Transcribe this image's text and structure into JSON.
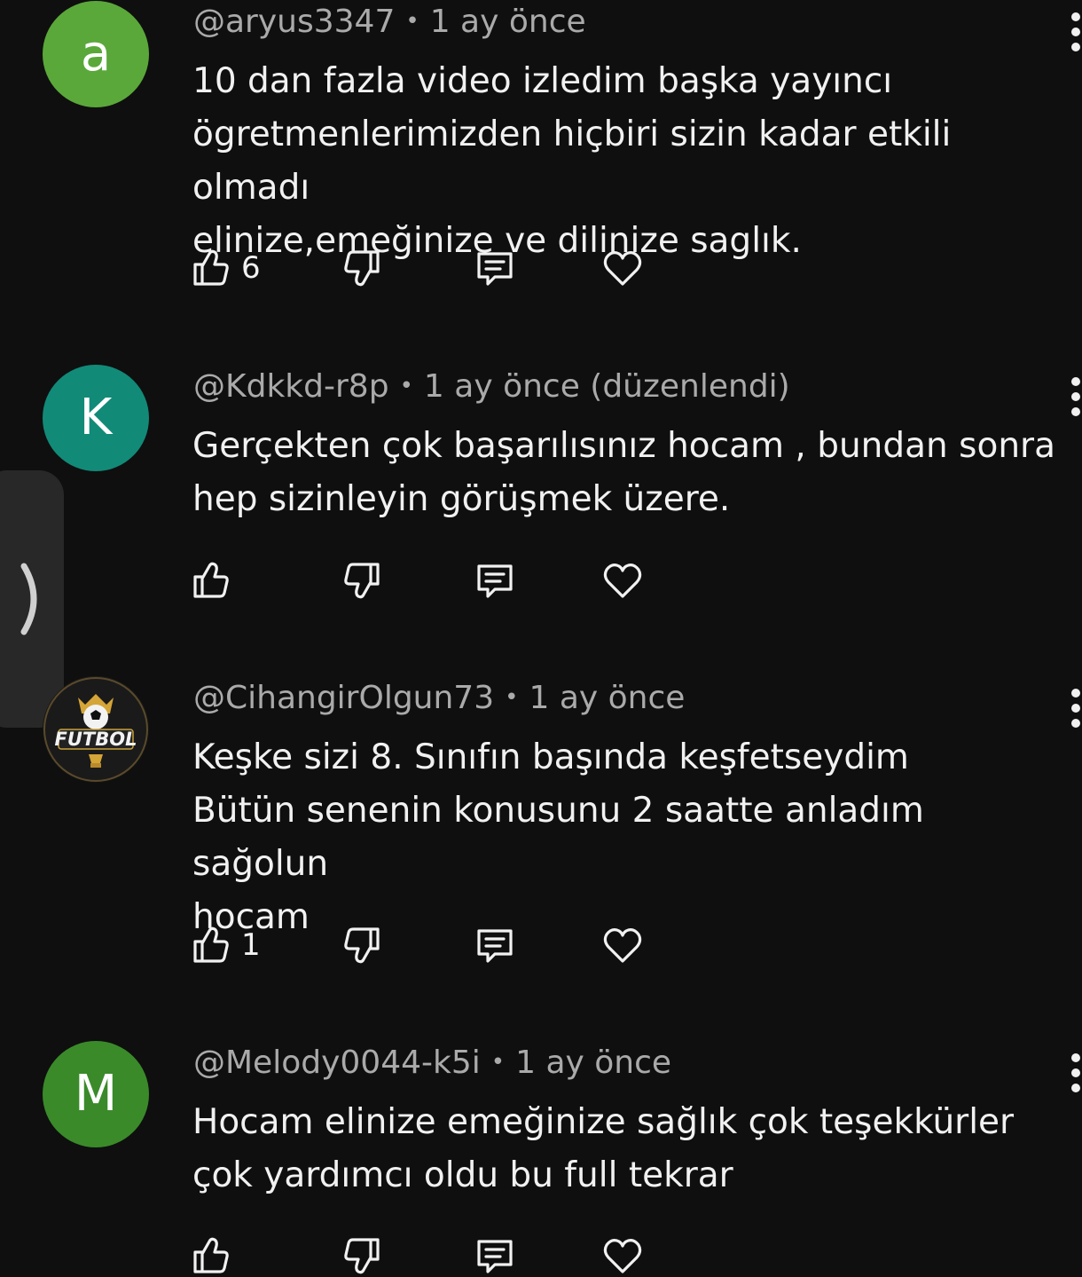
{
  "comments": [
    {
      "username": "@aryus3347",
      "time": "1 ay önce",
      "text": "10 dan fazla video izledim başka yayıncı\nögretmenlerimizden hiçbiri sizin kadar etkili olmadı\nelinize,emeğinize ve dilinize saglık.",
      "likes": "6",
      "avatar_letter": "a",
      "avatar_color": "#5aa83a"
    },
    {
      "username": "@Kdkkd-r8p",
      "time": "1 ay önce (düzenlendi)",
      "text": "Gerçekten çok başarılısınız hocam , bundan sonra\nhep sizinleyin görüşmek üzere.",
      "likes": "",
      "avatar_letter": "K",
      "avatar_color": "#128a78"
    },
    {
      "username": "@CihangirOlgun73",
      "time": "1 ay önce",
      "text": "Keşke sizi 8. Sınıfın başında keşfetseydim\nBütün senenin konusunu 2 saatte anladım sağolun\nhocam",
      "likes": "1",
      "avatar_logo_text": "FUTBOL"
    },
    {
      "username": "@Melody0044-k5i",
      "time": "1 ay önce",
      "text": "Hocam elinize  emeğinize sağlık çok teşekkürler\nçok yardımcı oldu bu full tekrar",
      "likes": "",
      "avatar_letter": "M",
      "avatar_color": "#3a8a2a"
    }
  ],
  "separator": "•",
  "icons": {
    "like": "thumbs-up-icon",
    "dislike": "thumbs-down-icon",
    "reply": "reply-comment-icon",
    "heart": "heart-icon",
    "more": "more-vertical-icon",
    "side": "chevron-right-icon"
  }
}
